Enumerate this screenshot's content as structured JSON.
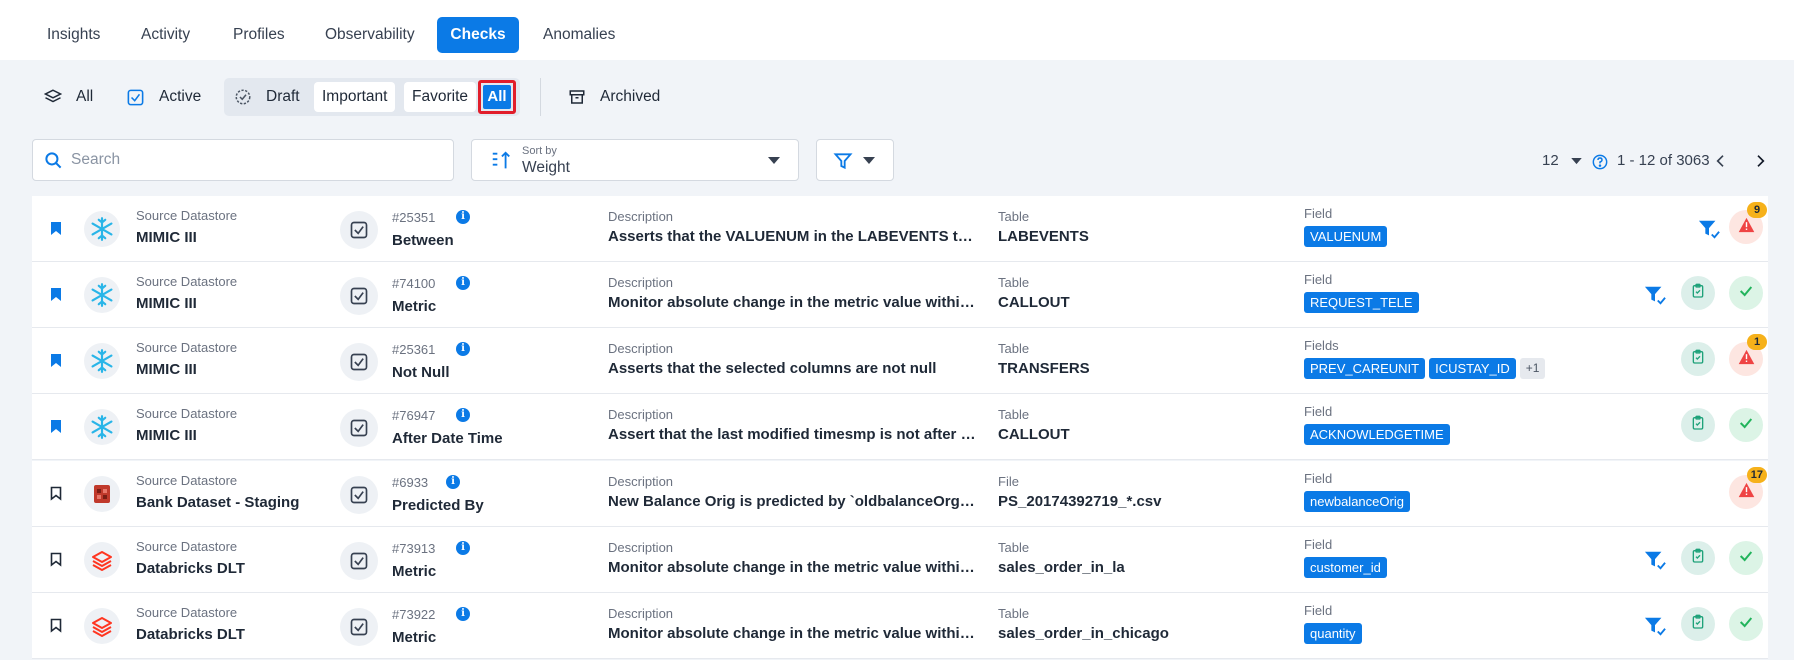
{
  "tabs": [
    {
      "label": "Insights"
    },
    {
      "label": "Activity"
    },
    {
      "label": "Profiles"
    },
    {
      "label": "Observability"
    },
    {
      "label": "Checks"
    },
    {
      "label": "Anomalies"
    }
  ],
  "status_filters": {
    "all": "All",
    "active": "Active",
    "draft": "Draft",
    "important": "Important",
    "favorite": "Favorite",
    "all_selected": "All",
    "archived": "Archived"
  },
  "search": {
    "placeholder": "Search"
  },
  "sort": {
    "label": "Sort by",
    "value": "Weight"
  },
  "pagination": {
    "page_size": "12",
    "range": "1 - 12 of 3063"
  },
  "labels": {
    "source_datastore": "Source Datastore",
    "description": "Description",
    "table": "Table",
    "file": "File",
    "field": "Field",
    "fields": "Fields"
  },
  "colors": {
    "accent": "#0b7ae6",
    "highlight_outline": "#e11d2a",
    "success": "#22b45c",
    "anomaly": "#ef4444",
    "count_badge": "#f6b11a"
  },
  "rows": [
    {
      "bookmarked": true,
      "datastore": "MIMIC III",
      "logo": "snowflake-icon",
      "id": "#25351",
      "rule": "Between",
      "description": "Asserts that the VALUENUM in the LABEVENTS table for...",
      "container_label": "Table",
      "container": "LABEVENTS",
      "field_label": "Field",
      "tags": [
        "VALUENUM"
      ],
      "more": "",
      "anomalies": "9",
      "status": "anomaly"
    },
    {
      "bookmarked": true,
      "datastore": "MIMIC III",
      "logo": "snowflake-icon",
      "id": "#74100",
      "rule": "Metric",
      "description": "Monitor absolute change in the metric value within the ...",
      "container_label": "Table",
      "container": "CALLOUT",
      "field_label": "Field",
      "tags": [
        "REQUEST_TELE"
      ],
      "more": "",
      "anomalies": "",
      "status": "pass"
    },
    {
      "bookmarked": true,
      "datastore": "MIMIC III",
      "logo": "snowflake-icon",
      "id": "#25361",
      "rule": "Not Null",
      "description": "Asserts that the selected columns are not null",
      "container_label": "Table",
      "container": "TRANSFERS",
      "field_label": "Fields",
      "tags": [
        "PREV_CAREUNIT",
        "ICUSTAY_ID"
      ],
      "more": "+1",
      "anomalies": "1",
      "status": "anomaly"
    },
    {
      "bookmarked": true,
      "datastore": "MIMIC III",
      "logo": "snowflake-icon",
      "id": "#76947",
      "rule": "After Date Time",
      "description": "Assert that the last modified timesmp is not after the d...",
      "container_label": "Table",
      "container": "CALLOUT",
      "field_label": "Field",
      "tags": [
        "ACKNOWLEDGETIME"
      ],
      "more": "",
      "anomalies": "",
      "status": "pass"
    },
    {
      "bookmarked": false,
      "datastore": "Bank Dataset - Staging",
      "logo": "bank-datastore-icon",
      "id": "#6933",
      "rule": "Predicted By",
      "description": "New Balance Orig is predicted by `oldbalanceOrg` - `a...",
      "container_label": "File",
      "container": "PS_20174392719_*.csv",
      "field_label": "Field",
      "tags": [
        "newbalanceOrig"
      ],
      "more": "",
      "anomalies": "17",
      "status": "anomaly"
    },
    {
      "bookmarked": false,
      "datastore": "Databricks DLT",
      "logo": "databricks-icon",
      "id": "#73913",
      "rule": "Metric",
      "description": "Monitor absolute change in the metric value within the ...",
      "container_label": "Table",
      "container": "sales_order_in_la",
      "field_label": "Field",
      "tags": [
        "customer_id"
      ],
      "more": "",
      "anomalies": "",
      "status": "pass"
    },
    {
      "bookmarked": false,
      "datastore": "Databricks DLT",
      "logo": "databricks-icon",
      "id": "#73922",
      "rule": "Metric",
      "description": "Monitor absolute change in the metric value within the ...",
      "container_label": "Table",
      "container": "sales_order_in_chicago",
      "field_label": "Field",
      "tags": [
        "quantity"
      ],
      "more": "",
      "anomalies": "",
      "status": "pass"
    }
  ]
}
